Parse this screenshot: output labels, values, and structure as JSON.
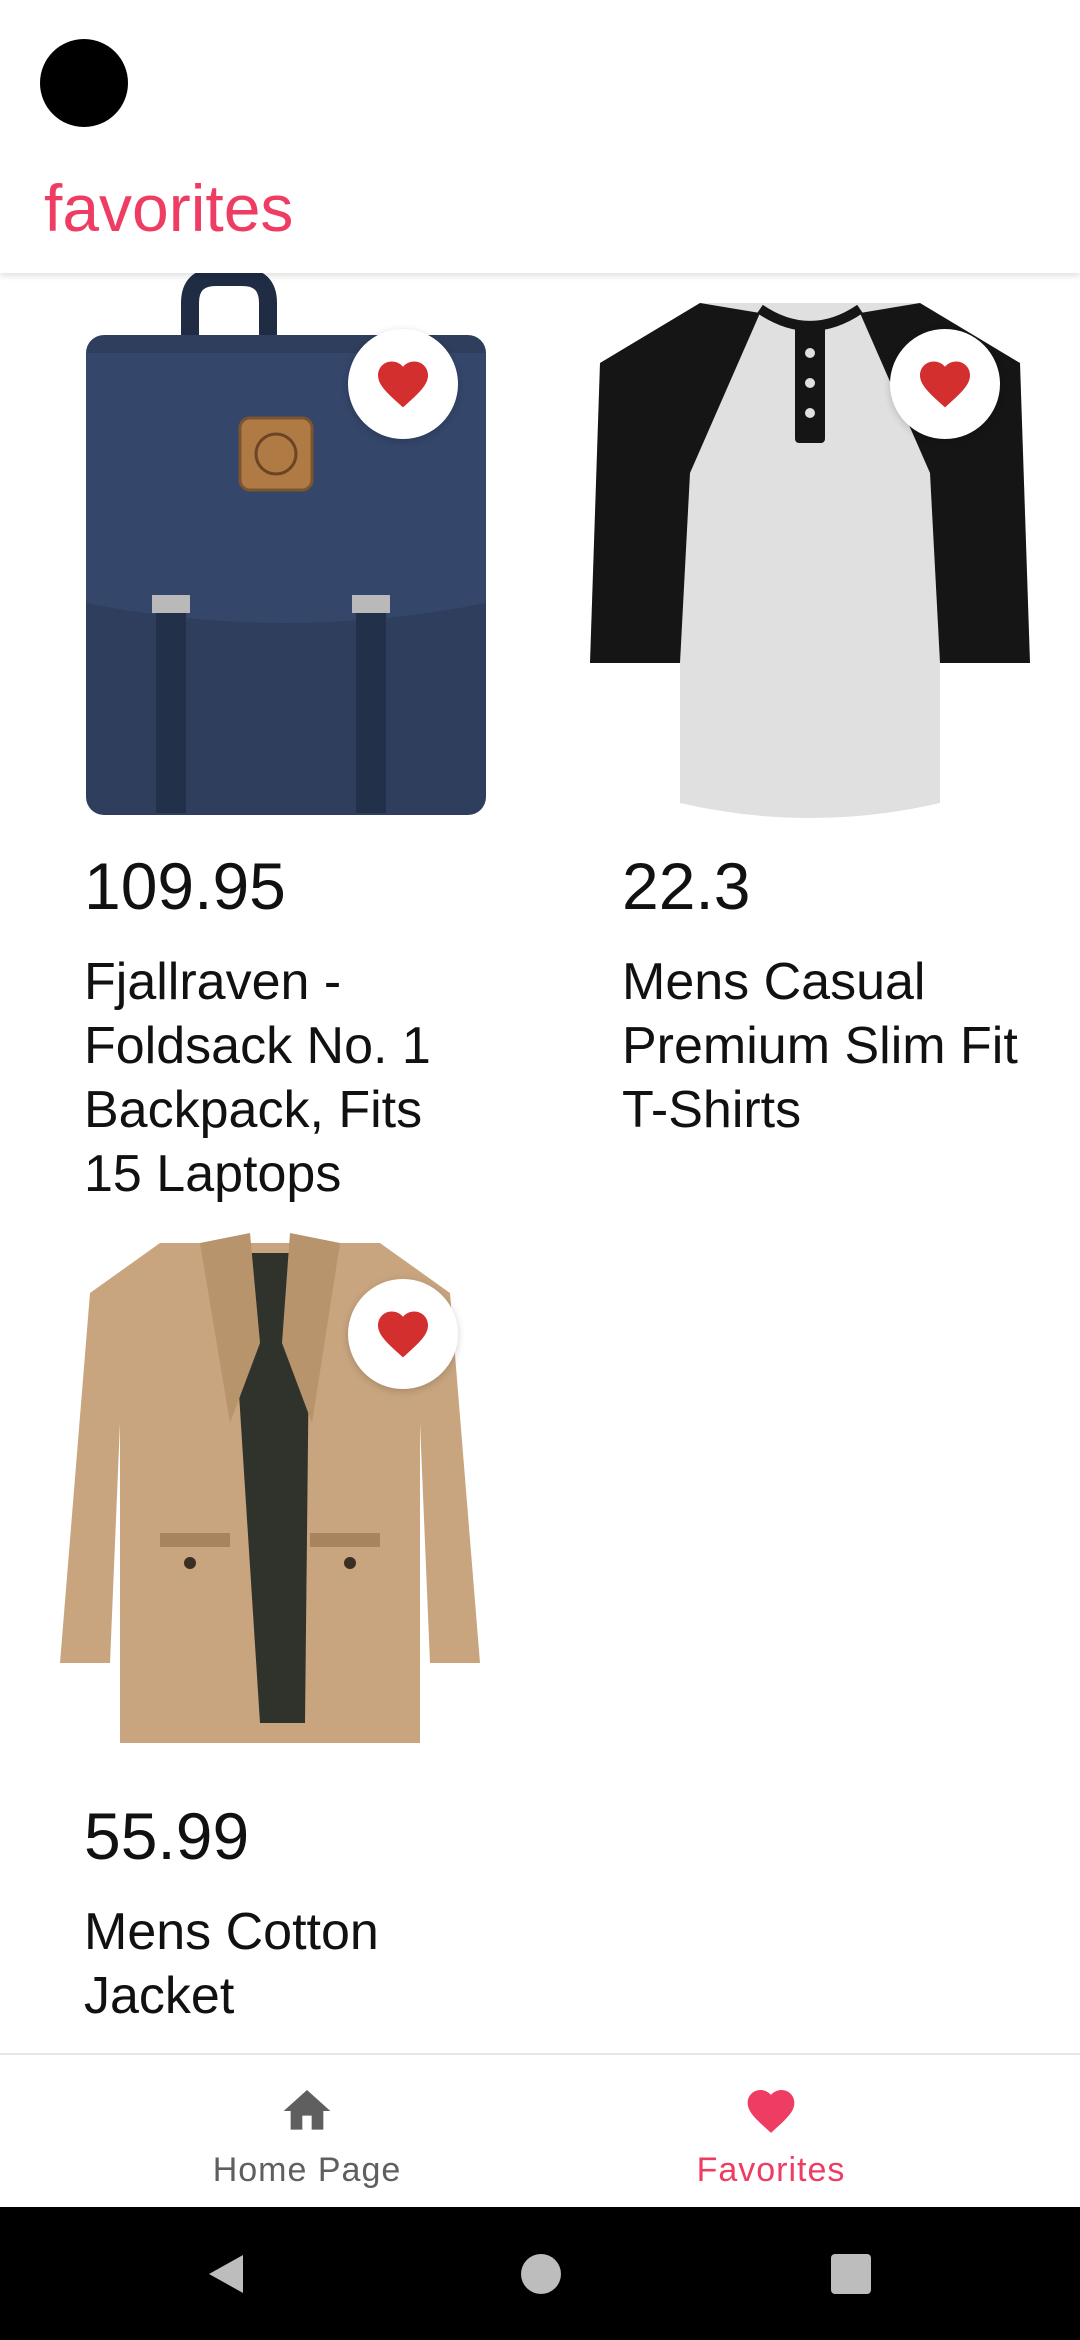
{
  "header": {
    "title": "favorites"
  },
  "colors": {
    "accent": "#ee3c63",
    "heart": "#d32f2f",
    "nav_inactive": "#5f5f5f"
  },
  "products": [
    {
      "price": "109.95",
      "name": "Fjallraven - Foldsack No. 1 Backpack, Fits 15 Laptops",
      "image": "navy-backpack",
      "favorite": true
    },
    {
      "price": "22.3",
      "name": "Mens Casual Premium Slim Fit T-Shirts",
      "image": "raglan-henley-shirt",
      "favorite": true
    },
    {
      "price": "55.99",
      "name": "Mens Cotton Jacket",
      "image": "khaki-jacket",
      "favorite": true
    }
  ],
  "bottom_nav": {
    "items": [
      {
        "label": "Home Page",
        "icon": "home-icon",
        "active": false
      },
      {
        "label": "Favorites",
        "icon": "heart-icon",
        "active": true
      }
    ]
  },
  "system_nav": {
    "buttons": [
      "back-icon",
      "home-circle-icon",
      "recents-icon"
    ]
  }
}
